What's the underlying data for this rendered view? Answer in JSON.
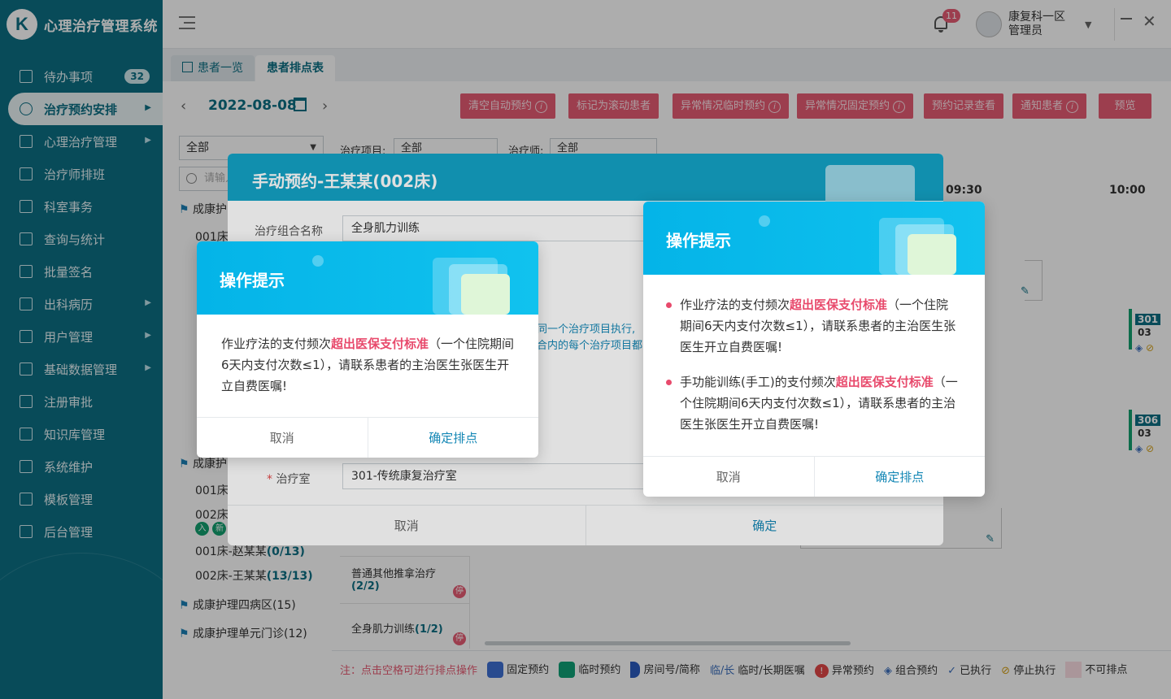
{
  "app": {
    "title": "心理治疗管理系统",
    "logo_letter": "K"
  },
  "sidebar": {
    "items": [
      {
        "label": "待办事项",
        "badge": "32"
      },
      {
        "label": "治疗预约安排"
      },
      {
        "label": "心理治疗管理"
      },
      {
        "label": "治疗师排班"
      },
      {
        "label": "科室事务"
      },
      {
        "label": "查询与统计"
      },
      {
        "label": "批量签名"
      },
      {
        "label": "出科病历"
      },
      {
        "label": "用户管理"
      },
      {
        "label": "基础数据管理"
      },
      {
        "label": "注册审批"
      },
      {
        "label": "知识库管理"
      },
      {
        "label": "系统维护"
      },
      {
        "label": "模板管理"
      },
      {
        "label": "后台管理"
      }
    ]
  },
  "header": {
    "notif_count": "11",
    "user_line1": "康复科一区",
    "user_line2": "管理员"
  },
  "tabs": [
    {
      "label": "患者一览"
    },
    {
      "label": "患者排点表"
    }
  ],
  "toolbar": {
    "date": "2022-08-08",
    "buttons": [
      "清空自动预约",
      "标记为滚动患者",
      "异常情况临时预约",
      "异常情况固定预约",
      "预约记录查看",
      "通知患者",
      "预览"
    ]
  },
  "filters": {
    "all": "全部",
    "search_placeholder": "请输入",
    "project_label": "治疗项目:",
    "project_value": "全部",
    "therapist_label": "治疗师:",
    "therapist_value": "全部"
  },
  "timeline": {
    "t1": "09:30",
    "t2": "10:00"
  },
  "tree": {
    "g1": "成康护",
    "g1a": "001床",
    "g2": "成康护",
    "g2a": "001床-",
    "g2b": "002床-",
    "n1": "001床-赵某某",
    "n1c": "(0/13)",
    "n2": "002床-王某某",
    "n2c": "(13/13)",
    "g3": "成康护理四病区(15)",
    "g4": "成康护理单元门诊(12)",
    "tag_in": "入",
    "tag_new": "新"
  },
  "rooms": [
    {
      "no": "301",
      "suffix": "03"
    },
    {
      "no": "306",
      "suffix": "03"
    }
  ],
  "treat_rows": [
    {
      "name": "普通其他推拿治疗",
      "count": "(2/2)",
      "tag": "停"
    },
    {
      "name": "全身肌力训练",
      "count": "(1/2)",
      "tag": "停"
    }
  ],
  "legend": {
    "note": "注：点击空格可进行排点操作",
    "items": [
      "固定预约",
      "临时预约",
      "房间号/简称",
      "临时/长期医嘱",
      "异常预约",
      "组合预约",
      "已执行",
      "停止执行",
      "不可排点"
    ],
    "temp_long": "临/长"
  },
  "manual_dialog": {
    "title": "手动预约-王某某(002床)",
    "combo_label": "治疗组合名称",
    "combo_value": "全身肌力训练",
    "room_label": "治疗室",
    "room_value": "301-传统康复治疗室",
    "cancel": "取消",
    "ok": "确定",
    "partial_text1": "同一个治疗项目执行,",
    "partial_text2": "合内的每个治疗项目都"
  },
  "popup_left": {
    "title": "操作提示",
    "pre": "作业疗法的支付频次",
    "highlight": "超出医保支付标准",
    "post": "（一个住院期间6天内支付次数≤1），请联系患者的主治医生张医生开立自费医嘱!",
    "cancel": "取消",
    "confirm": "确定排点"
  },
  "popup_right": {
    "title": "操作提示",
    "item1_pre": "作业疗法的支付频次",
    "item1_hl": "超出医保支付标准",
    "item1_post": "（一个住院期间6天内支付次数≤1），请联系患者的主治医生张医生开立自费医嘱!",
    "item2_pre": "手功能训练(手工)的支付频次",
    "item2_hl": "超出医保支付标准",
    "item2_post": "（一个住院期间6天内支付次数≤1），请联系患者的主治医生张医生开立自费医嘱!",
    "cancel": "取消",
    "confirm": "确定排点"
  },
  "colors": {
    "sidebar": "#0c6f84",
    "accent_red": "#e65c74",
    "popup_header": "#04b4e8",
    "highlight": "#e84a6c"
  }
}
